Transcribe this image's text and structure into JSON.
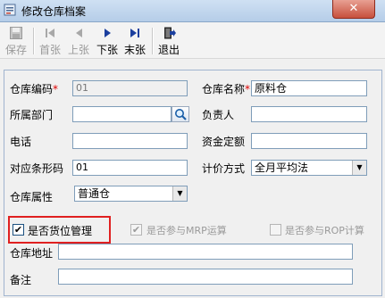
{
  "window": {
    "title": "修改仓库档案",
    "close_glyph": "✕"
  },
  "toolbar": [
    {
      "label": "保存",
      "enabled": false,
      "icon": "save-icon"
    },
    {
      "label": "首张",
      "enabled": false,
      "icon": "first-record-icon"
    },
    {
      "label": "上张",
      "enabled": false,
      "icon": "previous-record-icon"
    },
    {
      "label": "下张",
      "enabled": true,
      "icon": "next-record-icon"
    },
    {
      "label": "末张",
      "enabled": true,
      "icon": "last-record-icon"
    },
    {
      "label": "退出",
      "enabled": true,
      "icon": "exit-icon"
    }
  ],
  "form": {
    "warehouse_code": {
      "label": "仓库编码",
      "required": "*",
      "value": "01"
    },
    "warehouse_name": {
      "label": "仓库名称",
      "required": "*",
      "value": "原料仓"
    },
    "department": {
      "label": "所属部门",
      "value": ""
    },
    "manager": {
      "label": "负责人",
      "value": ""
    },
    "phone": {
      "label": "电话",
      "value": ""
    },
    "fund_quota": {
      "label": "资金定额",
      "value": ""
    },
    "barcode": {
      "label": "对应条形码",
      "value": "01"
    },
    "pricing_method": {
      "label": "计价方式",
      "value": "全月平均法"
    },
    "warehouse_attr": {
      "label": "仓库属性",
      "value": "普通仓"
    },
    "location_mgmt": {
      "label": "是否货位管理",
      "checked": true
    },
    "mrp": {
      "label": "是否参与MRP运算",
      "checked": true,
      "enabled": false
    },
    "rop": {
      "label": "是否参与ROP计算",
      "checked": false,
      "enabled": false
    },
    "address": {
      "label": "仓库地址",
      "value": ""
    },
    "note": {
      "label": "备注",
      "value": ""
    }
  },
  "colors": {
    "required": "#d00000",
    "highlight": "#e02020",
    "accent": "#1b3f9e"
  }
}
